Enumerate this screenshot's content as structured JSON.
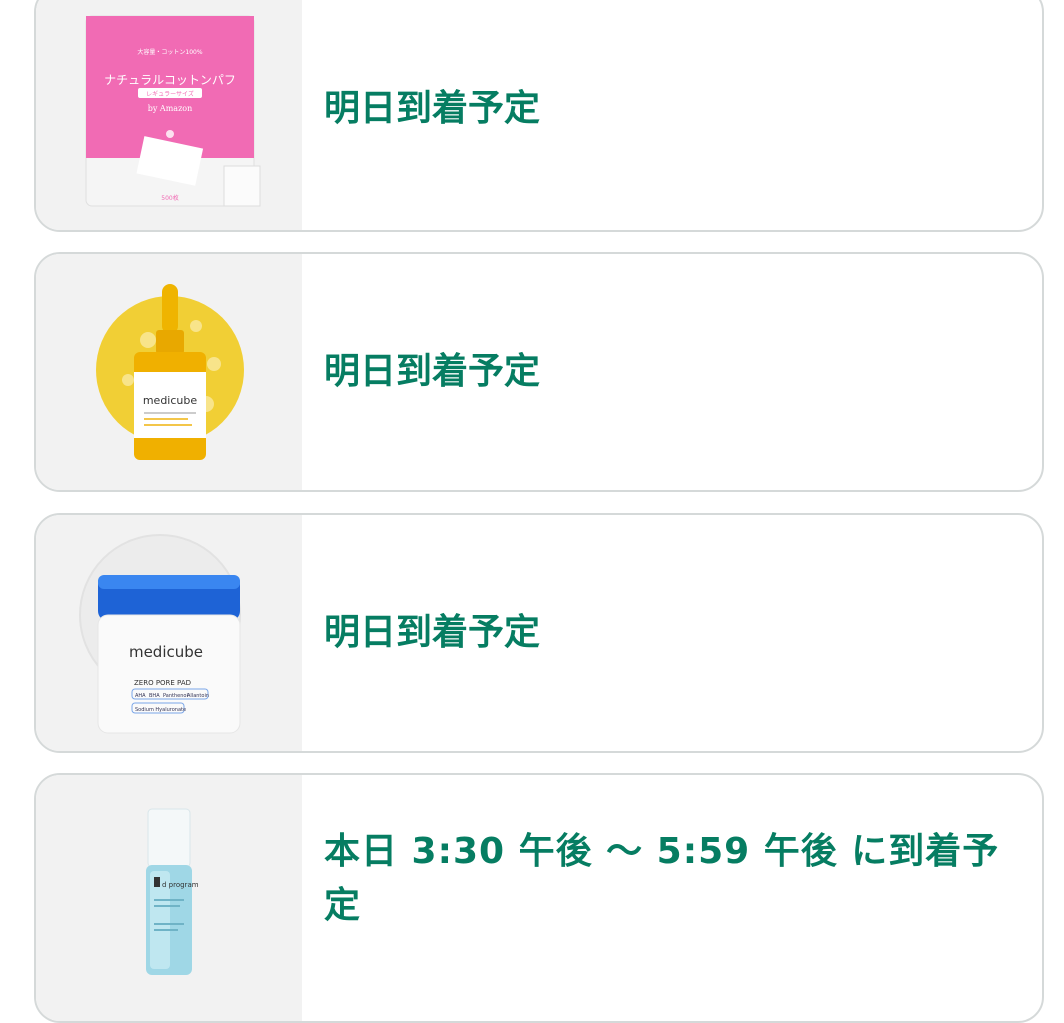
{
  "items": [
    {
      "product_icon": "cotton-pads-package",
      "delivery_text": "明日到着予定",
      "package_text": {
        "line1": "大容量・コットン100%",
        "title": "ナチュラルコットンパフ",
        "size_tag": "レギュラーサイズ",
        "brand": "by Amazon",
        "count": "500枚"
      }
    },
    {
      "product_icon": "serum-bottle",
      "delivery_text": "明日到着予定",
      "package_text": {
        "brand": "medicube"
      }
    },
    {
      "product_icon": "toner-pad-jar",
      "delivery_text": "明日到着予定",
      "package_text": {
        "brand": "medicube",
        "name": "ZERO PORE PAD",
        "ingredients": [
          "AHA",
          "BHA",
          "Panthenol",
          "Allantoin"
        ],
        "ingredient2": "Sodium Hyaluronate"
      }
    },
    {
      "product_icon": "lotion-bottle",
      "delivery_text": "本日 3:30 午後 〜 5:59 午後 に到着予定",
      "package_text": {
        "brand": "d program"
      }
    }
  ],
  "colors": {
    "delivery_green": "#067d62",
    "card_border": "#d5d9d9",
    "thumb_bg": "#f2f2f2"
  }
}
